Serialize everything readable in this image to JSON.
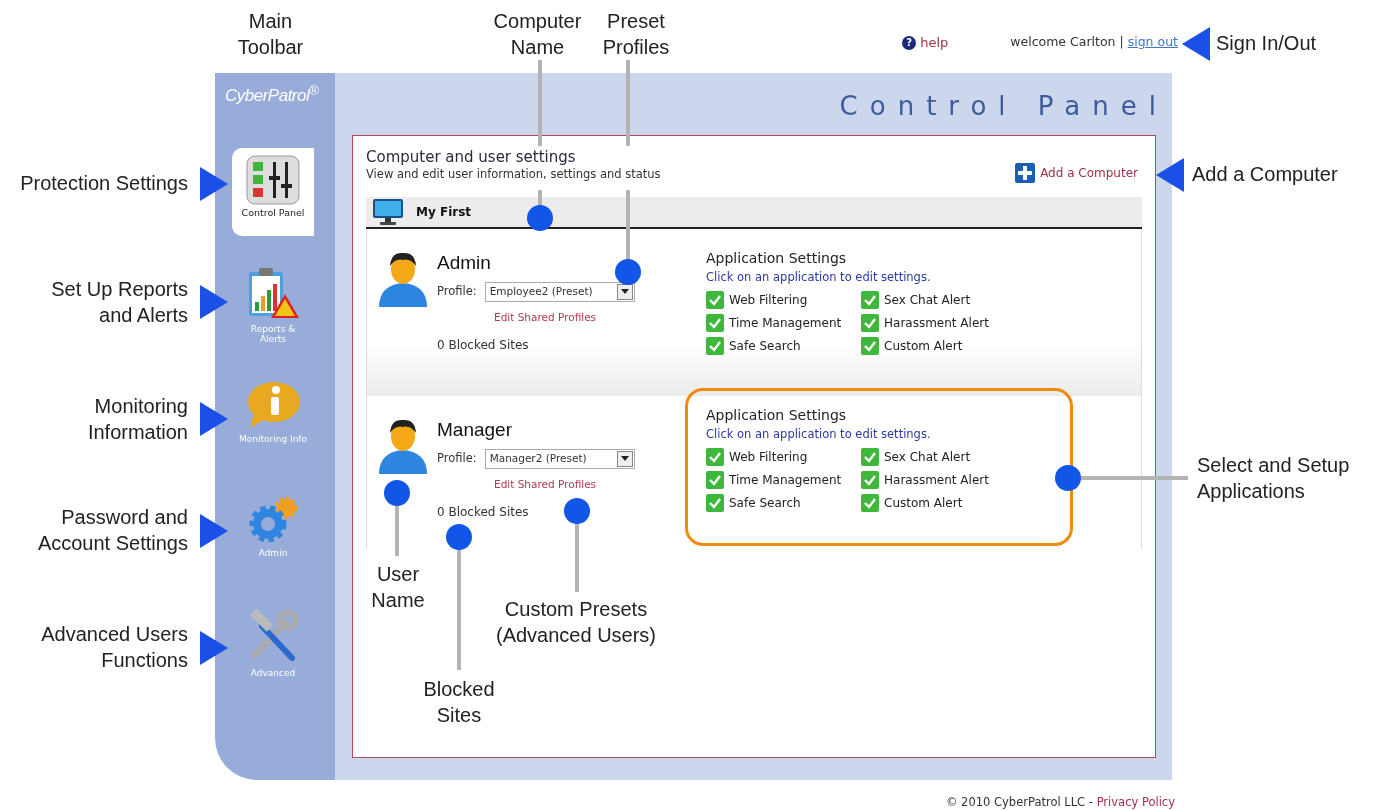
{
  "top_bar": {
    "help_icon": "?",
    "help": "help",
    "welcome": "welcome Carlton",
    "separator": "|",
    "sign_out": "sign out"
  },
  "logo": "CyberPatrol$^{®}$",
  "sidebar": {
    "items": [
      {
        "label": "Control Panel",
        "kind": "control",
        "selected": true
      },
      {
        "label": "Reports & Alerts",
        "kind": "reports",
        "selected": false
      },
      {
        "label": "Monitoring Info",
        "kind": "info",
        "selected": false
      },
      {
        "label": "Admin",
        "kind": "admin",
        "selected": false
      },
      {
        "label": "Advanced",
        "kind": "tools",
        "selected": false
      }
    ]
  },
  "title": "Control Panel",
  "section": {
    "title": "Computer and user settings",
    "subtitle": "View and edit user information, settings and status",
    "add_computer": "Add a Computer"
  },
  "computer": {
    "name": "My First"
  },
  "users": [
    {
      "name": "Admin",
      "profile_label": "Profile:",
      "profile": "Employee2 (Preset)",
      "edit_link": "Edit Shared Profiles",
      "blocked": "0 Blocked Sites",
      "highlighted": false,
      "apps_title": "Application Settings",
      "apps_hint": "Click on an application to edit settings.",
      "apps": [
        {
          "label": "Web Filtering",
          "checked": true
        },
        {
          "label": "Sex Chat Alert",
          "checked": true
        },
        {
          "label": "Time Management",
          "checked": true
        },
        {
          "label": "Harassment Alert",
          "checked": true
        },
        {
          "label": "Safe Search",
          "checked": true
        },
        {
          "label": "Custom Alert",
          "checked": true
        }
      ]
    },
    {
      "name": "Manager",
      "profile_label": "Profile:",
      "profile": "Manager2 (Preset)",
      "edit_link": "Edit Shared Profiles",
      "blocked": "0 Blocked Sites",
      "highlighted": true,
      "apps_title": "Application Settings",
      "apps_hint": "Click on an application to edit settings.",
      "apps": [
        {
          "label": "Web Filtering",
          "checked": true
        },
        {
          "label": "Sex Chat Alert",
          "checked": true
        },
        {
          "label": "Time Management",
          "checked": true
        },
        {
          "label": "Harassment Alert",
          "checked": true
        },
        {
          "label": "Safe Search",
          "checked": true
        },
        {
          "label": "Custom Alert",
          "checked": true
        }
      ]
    }
  ],
  "footer": {
    "copyright": "© 2010 CyberPatrol LLC -",
    "privacy": "Privacy Policy"
  },
  "annotations": [
    {
      "text": "Main\nToolbar",
      "kind": "label"
    },
    {
      "text": "Computer\nName",
      "kind": "pin"
    },
    {
      "text": "Preset\nProfiles",
      "kind": "pin"
    },
    {
      "text": "Sign In/Out",
      "kind": "arrow"
    },
    {
      "text": "Protection Settings",
      "kind": "arrow"
    },
    {
      "text": "Set Up Reports\nand Alerts",
      "kind": "arrow"
    },
    {
      "text": "Monitoring\nInformation",
      "kind": "arrow"
    },
    {
      "text": "Password and\nAccount Settings",
      "kind": "arrow"
    },
    {
      "text": "Advanced Users\nFunctions",
      "kind": "arrow"
    },
    {
      "text": "Add a Computer",
      "kind": "arrow"
    },
    {
      "text": "Select and Setup\nApplications",
      "kind": "pin"
    },
    {
      "text": "User\nName",
      "kind": "pin"
    },
    {
      "text": "Blocked\nSites",
      "kind": "pin"
    },
    {
      "text": "Custom Presets\n(Advanced Users)",
      "kind": "pin"
    }
  ]
}
